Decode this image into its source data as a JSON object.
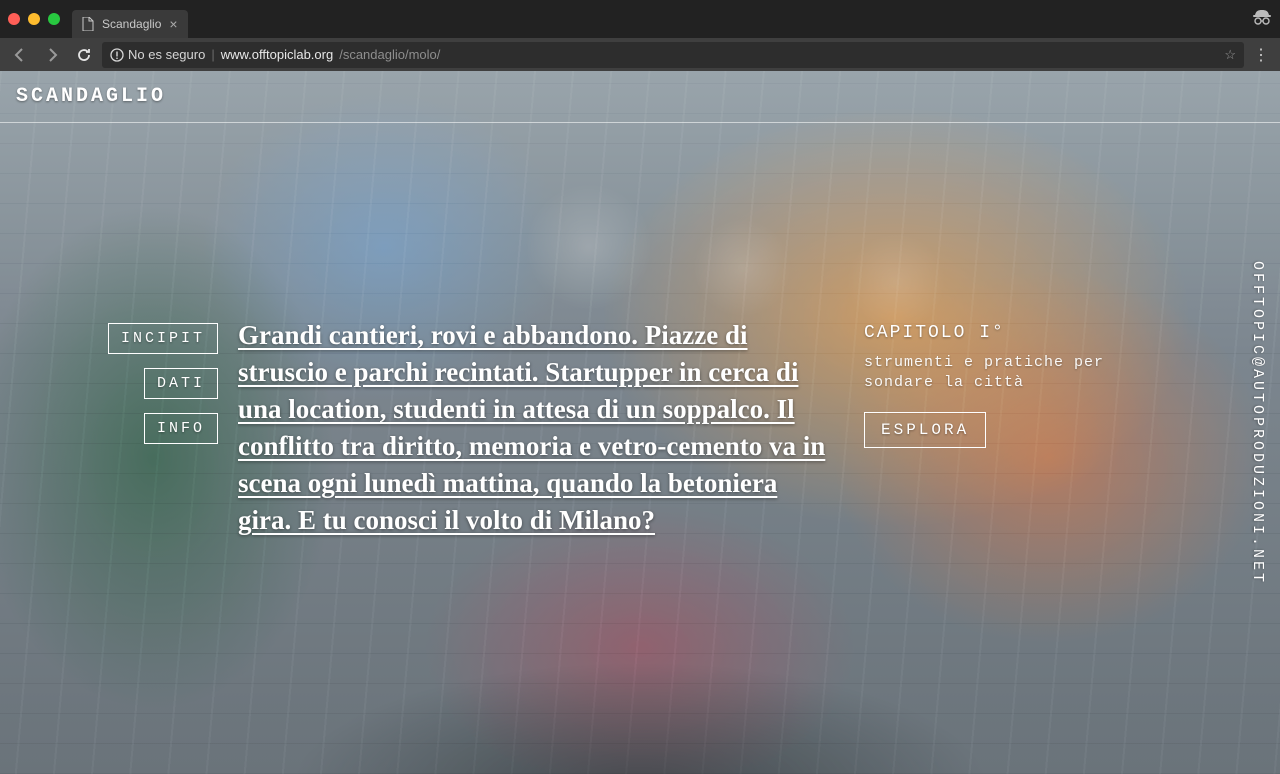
{
  "browser": {
    "tab_title": "Scandaglio",
    "insecure_label": "No es seguro",
    "url_host": "www.offtopiclab.org",
    "url_path": "/scandaglio/molo/"
  },
  "header": {
    "title": "SCANDAGLIO"
  },
  "nav": {
    "incipit": "INCIPIT",
    "dati": "DATI",
    "info": "INFO"
  },
  "hero": {
    "text": "Grandi cantieri, rovi e abbandono. Piazze di struscio e parchi recintati. Startupper in cerca di una location, studenti in attesa di un soppalco. Il conflitto tra diritto, memoria e vetro-cemento va in scena ogni lunedì mattina, quando la betoniera gira. E tu conosci il volto di Milano?"
  },
  "chapter": {
    "label": "CAPITOLO I°",
    "subtitle": "strumenti e pratiche per sondare la città",
    "cta": "ESPLORA"
  },
  "contact": {
    "email": "OFFTOPIC@AUTOPRODUZIONI.NET"
  }
}
